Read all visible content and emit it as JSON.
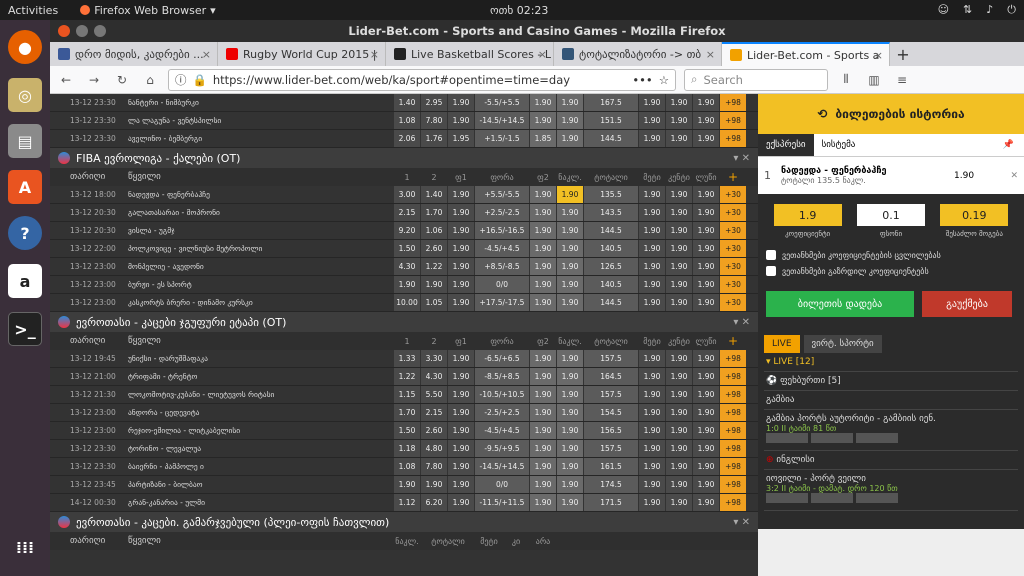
{
  "topbar": {
    "activities": "Activities",
    "app": "Firefox Web Browser",
    "clock": "ოთხ 02:23"
  },
  "window": {
    "title": "Lider-Bet.com - Sports and Casino Games - Mozilla Firefox"
  },
  "tabs": [
    {
      "label": "დრო მიდის, კადრები ...",
      "color": "#3b5998"
    },
    {
      "label": "Rugby World Cup 2015 |",
      "color": "#e00"
    },
    {
      "label": "Live Basketball Scores - L",
      "color": "#222"
    },
    {
      "label": "ტოტალიზატორი -> თბ",
      "color": "#357"
    },
    {
      "label": "Lider-Bet.com - Sports a",
      "color": "#f2a100"
    }
  ],
  "nav": {
    "url": "https://www.lider-bet.com/web/ka/sport#opentime=time=day",
    "search_placeholder": "Search"
  },
  "top_rows": [
    {
      "d": "13-12 23:30",
      "t": "ნანტერი - ნიმბურკი",
      "o": [
        "1.40",
        "2.95",
        "1.90",
        "-5.5/+5.5",
        "1.90",
        "1.90",
        "167.5",
        "1.90",
        "1.90",
        "1.90",
        "+98"
      ]
    },
    {
      "d": "13-12 23:30",
      "t": "ლა ლაგუნა - ვენტსპილსი",
      "o": [
        "1.08",
        "7.80",
        "1.90",
        "-14.5/+14.5",
        "1.90",
        "1.90",
        "151.5",
        "1.90",
        "1.90",
        "1.90",
        "+98"
      ]
    },
    {
      "d": "13-12 23:30",
      "t": "აველინო - ბემბერგი",
      "o": [
        "2.06",
        "1.76",
        "1.95",
        "+1.5/-1.5",
        "1.85",
        "1.90",
        "144.5",
        "1.90",
        "1.90",
        "1.90",
        "+98"
      ]
    }
  ],
  "sections": [
    {
      "title": "FIBA ევროლიგა - ქალები (OT)",
      "head": {
        "date": "თარიღი",
        "team": "წყვილი",
        "cols": [
          "1",
          "2",
          "ფ1",
          "ფორა",
          "ფ2",
          "ნაკლ.",
          "ტოტალი",
          "მეტი",
          "კენტი",
          "ლუწი",
          "+"
        ]
      },
      "rows": [
        {
          "d": "13-12 18:00",
          "t": "ნადეჟდა - ფენერბაჰჩე",
          "o": [
            "3.00",
            "1.40",
            "1.90",
            "+5.5/-5.5",
            "1.90",
            "1.90",
            "135.5",
            "1.90",
            "1.90",
            "1.90",
            "+30"
          ]
        },
        {
          "d": "13-12 20:30",
          "t": "გალათასარაი - მოპრონი",
          "o": [
            "2.15",
            "1.70",
            "1.90",
            "+2.5/-2.5",
            "1.90",
            "1.90",
            "143.5",
            "1.90",
            "1.90",
            "1.90",
            "+30"
          ]
        },
        {
          "d": "13-12 20:30",
          "t": "ვისლა - უგმჯ",
          "o": [
            "9.20",
            "1.06",
            "1.90",
            "+16.5/-16.5",
            "1.90",
            "1.90",
            "144.5",
            "1.90",
            "1.90",
            "1.90",
            "+30"
          ]
        },
        {
          "d": "13-12 22:00",
          "t": "პოლკოვიცე - ვილნიუსი მეტროპოლი",
          "o": [
            "1.50",
            "2.60",
            "1.90",
            "-4.5/+4.5",
            "1.90",
            "1.90",
            "140.5",
            "1.90",
            "1.90",
            "1.90",
            "+30"
          ]
        },
        {
          "d": "13-12 23:00",
          "t": "მონპელიე - ავედონი",
          "o": [
            "4.30",
            "1.22",
            "1.90",
            "+8.5/-8.5",
            "1.90",
            "1.90",
            "126.5",
            "1.90",
            "1.90",
            "1.90",
            "+30"
          ]
        },
        {
          "d": "13-12 23:00",
          "t": "ბურჟი - ეს სპორტ",
          "o": [
            "1.90",
            "1.90",
            "1.90",
            "0/0",
            "1.90",
            "1.90",
            "140.5",
            "1.90",
            "1.90",
            "1.90",
            "+30"
          ]
        },
        {
          "d": "13-12 23:00",
          "t": "კასკორტს ბრერი - დინამო კურსკი",
          "o": [
            "10.00",
            "1.05",
            "1.90",
            "+17.5/-17.5",
            "1.90",
            "1.90",
            "144.5",
            "1.90",
            "1.90",
            "1.90",
            "+30"
          ]
        }
      ]
    },
    {
      "title": "ევროთასი - კაცები ჯგუფური ეტაპი (OT)",
      "head": {
        "date": "თარიღი",
        "team": "წყვილი",
        "cols": [
          "1",
          "2",
          "ფ1",
          "ფორა",
          "ფ2",
          "ნაკლ.",
          "ტოტალი",
          "მეტი",
          "კენტი",
          "ლუწი",
          "+"
        ]
      },
      "rows": [
        {
          "d": "13-12 19:45",
          "t": "უნიქსი - დარუშშაფაკა",
          "o": [
            "1.33",
            "3.30",
            "1.90",
            "-6.5/+6.5",
            "1.90",
            "1.90",
            "157.5",
            "1.90",
            "1.90",
            "1.90",
            "+98"
          ]
        },
        {
          "d": "13-12 21:00",
          "t": "ტრიფამი - ტრენტო",
          "o": [
            "1.22",
            "4.30",
            "1.90",
            "-8.5/+8.5",
            "1.90",
            "1.90",
            "164.5",
            "1.90",
            "1.90",
            "1.90",
            "+98"
          ]
        },
        {
          "d": "13-12 21:30",
          "t": "ლოკომოტივ-კუბანი - ლიეტუვოს რიტასი",
          "o": [
            "1.15",
            "5.50",
            "1.90",
            "-10.5/+10.5",
            "1.90",
            "1.90",
            "157.5",
            "1.90",
            "1.90",
            "1.90",
            "+98"
          ]
        },
        {
          "d": "13-12 23:00",
          "t": "ანდორა - ცედევიტა",
          "o": [
            "1.70",
            "2.15",
            "1.90",
            "-2.5/+2.5",
            "1.90",
            "1.90",
            "154.5",
            "1.90",
            "1.90",
            "1.90",
            "+98"
          ]
        },
        {
          "d": "13-12 23:00",
          "t": "რეჯიო-ემილია - ლიტკაბელისი",
          "o": [
            "1.50",
            "2.60",
            "1.90",
            "-4.5/+4.5",
            "1.90",
            "1.90",
            "156.5",
            "1.90",
            "1.90",
            "1.90",
            "+98"
          ]
        },
        {
          "d": "13-12 23:30",
          "t": "ტორინო - ლევალუა",
          "o": [
            "1.18",
            "4.80",
            "1.90",
            "-9.5/+9.5",
            "1.90",
            "1.90",
            "157.5",
            "1.90",
            "1.90",
            "1.90",
            "+98"
          ]
        },
        {
          "d": "13-12 23:30",
          "t": "ბაიერნი - პამპოლე ი",
          "o": [
            "1.08",
            "7.80",
            "1.90",
            "-14.5/+14.5",
            "1.90",
            "1.90",
            "161.5",
            "1.90",
            "1.90",
            "1.90",
            "+98"
          ]
        },
        {
          "d": "13-12 23:45",
          "t": "პარტიზანი - ბილბაო",
          "o": [
            "1.90",
            "1.90",
            "1.90",
            "0/0",
            "1.90",
            "1.90",
            "174.5",
            "1.90",
            "1.90",
            "1.90",
            "+98"
          ]
        },
        {
          "d": "14-12 00:30",
          "t": "გრან-კანარია - ულმი",
          "o": [
            "1.12",
            "6.20",
            "1.90",
            "-11.5/+11.5",
            "1.90",
            "1.90",
            "171.5",
            "1.90",
            "1.90",
            "1.90",
            "+98"
          ]
        }
      ]
    },
    {
      "title": "ევროთასი - კაცები. გამარჯვებული (პლეი-ოფის ჩათვლით)",
      "head": {
        "date": "თარიღი",
        "team": "წყვილი",
        "cols": [
          "ნაკლ.",
          "ტოტალი",
          "მეტი",
          "კი",
          "არა"
        ]
      },
      "rows": []
    }
  ],
  "betslip": {
    "title": "ბილეთების ისტორია",
    "tab1": "ექსპრესი",
    "tab2": "სისტემა",
    "num": "1",
    "match": "ნადეჟდა - ფენერბაჰჩე",
    "sub": "ტოტალი 135.5  ნაკლ.",
    "odd": "1.90",
    "coef": "1.9",
    "coef_label": "კოეფიციენტი",
    "stake": "0.1",
    "stake_label": "ფსონი",
    "win": "0.19",
    "win_label": "შესაძლო მოგება",
    "chk1": "ვეთანხმები კოეფიციენტების ცვლილებას",
    "chk2": "ვეთანხმები გაზრდილ კოეფიციენტებს",
    "place": "ბილეთის დადება",
    "clear": "გაუქმება"
  },
  "live": {
    "tab1": "LIVE",
    "tab2": "ვირტ. სპორტი",
    "count": "LIVE  [12]",
    "sport": "ფეხბურთი [5]",
    "g1": "გამბია",
    "m1": "გამბია პორტს აუტორიტი - გამბიის იენ.",
    "s1": "1:0 II ტაიმი 81 წთ",
    "g2": "ინგლისი",
    "m2": "იოვილი - პორტ ვეილი",
    "s2": "3:2 II ტაიმი - დამატ. დრო 120 წთ"
  }
}
